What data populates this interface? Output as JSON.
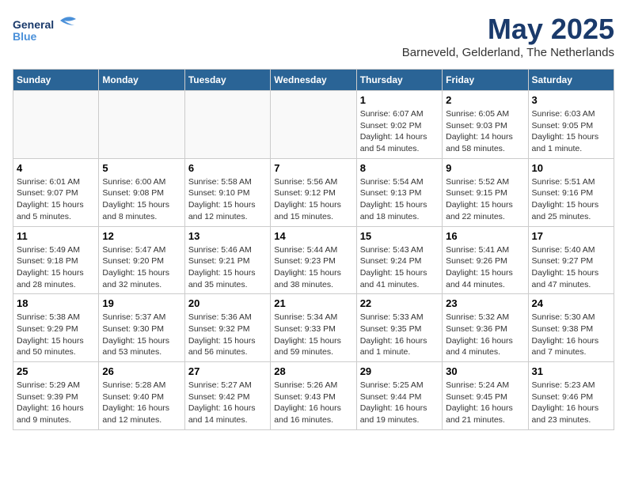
{
  "header": {
    "logo_general": "General",
    "logo_blue": "Blue",
    "month": "May 2025",
    "location": "Barneveld, Gelderland, The Netherlands"
  },
  "weekdays": [
    "Sunday",
    "Monday",
    "Tuesday",
    "Wednesday",
    "Thursday",
    "Friday",
    "Saturday"
  ],
  "weeks": [
    [
      {
        "day": "",
        "info": ""
      },
      {
        "day": "",
        "info": ""
      },
      {
        "day": "",
        "info": ""
      },
      {
        "day": "",
        "info": ""
      },
      {
        "day": "1",
        "info": "Sunrise: 6:07 AM\nSunset: 9:02 PM\nDaylight: 14 hours\nand 54 minutes."
      },
      {
        "day": "2",
        "info": "Sunrise: 6:05 AM\nSunset: 9:03 PM\nDaylight: 14 hours\nand 58 minutes."
      },
      {
        "day": "3",
        "info": "Sunrise: 6:03 AM\nSunset: 9:05 PM\nDaylight: 15 hours\nand 1 minute."
      }
    ],
    [
      {
        "day": "4",
        "info": "Sunrise: 6:01 AM\nSunset: 9:07 PM\nDaylight: 15 hours\nand 5 minutes."
      },
      {
        "day": "5",
        "info": "Sunrise: 6:00 AM\nSunset: 9:08 PM\nDaylight: 15 hours\nand 8 minutes."
      },
      {
        "day": "6",
        "info": "Sunrise: 5:58 AM\nSunset: 9:10 PM\nDaylight: 15 hours\nand 12 minutes."
      },
      {
        "day": "7",
        "info": "Sunrise: 5:56 AM\nSunset: 9:12 PM\nDaylight: 15 hours\nand 15 minutes."
      },
      {
        "day": "8",
        "info": "Sunrise: 5:54 AM\nSunset: 9:13 PM\nDaylight: 15 hours\nand 18 minutes."
      },
      {
        "day": "9",
        "info": "Sunrise: 5:52 AM\nSunset: 9:15 PM\nDaylight: 15 hours\nand 22 minutes."
      },
      {
        "day": "10",
        "info": "Sunrise: 5:51 AM\nSunset: 9:16 PM\nDaylight: 15 hours\nand 25 minutes."
      }
    ],
    [
      {
        "day": "11",
        "info": "Sunrise: 5:49 AM\nSunset: 9:18 PM\nDaylight: 15 hours\nand 28 minutes."
      },
      {
        "day": "12",
        "info": "Sunrise: 5:47 AM\nSunset: 9:20 PM\nDaylight: 15 hours\nand 32 minutes."
      },
      {
        "day": "13",
        "info": "Sunrise: 5:46 AM\nSunset: 9:21 PM\nDaylight: 15 hours\nand 35 minutes."
      },
      {
        "day": "14",
        "info": "Sunrise: 5:44 AM\nSunset: 9:23 PM\nDaylight: 15 hours\nand 38 minutes."
      },
      {
        "day": "15",
        "info": "Sunrise: 5:43 AM\nSunset: 9:24 PM\nDaylight: 15 hours\nand 41 minutes."
      },
      {
        "day": "16",
        "info": "Sunrise: 5:41 AM\nSunset: 9:26 PM\nDaylight: 15 hours\nand 44 minutes."
      },
      {
        "day": "17",
        "info": "Sunrise: 5:40 AM\nSunset: 9:27 PM\nDaylight: 15 hours\nand 47 minutes."
      }
    ],
    [
      {
        "day": "18",
        "info": "Sunrise: 5:38 AM\nSunset: 9:29 PM\nDaylight: 15 hours\nand 50 minutes."
      },
      {
        "day": "19",
        "info": "Sunrise: 5:37 AM\nSunset: 9:30 PM\nDaylight: 15 hours\nand 53 minutes."
      },
      {
        "day": "20",
        "info": "Sunrise: 5:36 AM\nSunset: 9:32 PM\nDaylight: 15 hours\nand 56 minutes."
      },
      {
        "day": "21",
        "info": "Sunrise: 5:34 AM\nSunset: 9:33 PM\nDaylight: 15 hours\nand 59 minutes."
      },
      {
        "day": "22",
        "info": "Sunrise: 5:33 AM\nSunset: 9:35 PM\nDaylight: 16 hours\nand 1 minute."
      },
      {
        "day": "23",
        "info": "Sunrise: 5:32 AM\nSunset: 9:36 PM\nDaylight: 16 hours\nand 4 minutes."
      },
      {
        "day": "24",
        "info": "Sunrise: 5:30 AM\nSunset: 9:38 PM\nDaylight: 16 hours\nand 7 minutes."
      }
    ],
    [
      {
        "day": "25",
        "info": "Sunrise: 5:29 AM\nSunset: 9:39 PM\nDaylight: 16 hours\nand 9 minutes."
      },
      {
        "day": "26",
        "info": "Sunrise: 5:28 AM\nSunset: 9:40 PM\nDaylight: 16 hours\nand 12 minutes."
      },
      {
        "day": "27",
        "info": "Sunrise: 5:27 AM\nSunset: 9:42 PM\nDaylight: 16 hours\nand 14 minutes."
      },
      {
        "day": "28",
        "info": "Sunrise: 5:26 AM\nSunset: 9:43 PM\nDaylight: 16 hours\nand 16 minutes."
      },
      {
        "day": "29",
        "info": "Sunrise: 5:25 AM\nSunset: 9:44 PM\nDaylight: 16 hours\nand 19 minutes."
      },
      {
        "day": "30",
        "info": "Sunrise: 5:24 AM\nSunset: 9:45 PM\nDaylight: 16 hours\nand 21 minutes."
      },
      {
        "day": "31",
        "info": "Sunrise: 5:23 AM\nSunset: 9:46 PM\nDaylight: 16 hours\nand 23 minutes."
      }
    ]
  ]
}
